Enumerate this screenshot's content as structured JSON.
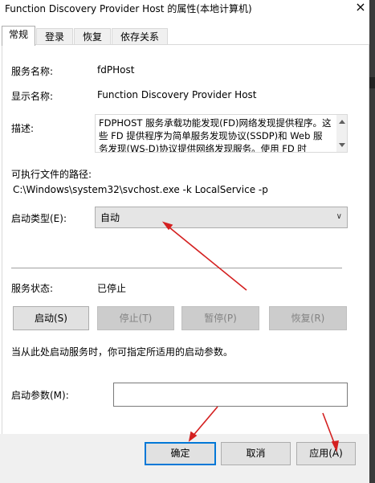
{
  "window": {
    "title": "Function Discovery Provider Host 的属性(本地计算机)",
    "close_glyph": "×"
  },
  "tabs": [
    {
      "label": "常规",
      "active": true
    },
    {
      "label": "登录",
      "active": false
    },
    {
      "label": "恢复",
      "active": false
    },
    {
      "label": "依存关系",
      "active": false
    }
  ],
  "general": {
    "service_name_label": "服务名称:",
    "service_name_value": "fdPHost",
    "display_name_label": "显示名称:",
    "display_name_value": "Function Discovery Provider Host",
    "description_label": "描述:",
    "description_text": "FDPHOST 服务承载功能发现(FD)网络发现提供程序。这些 FD 提供程序为简单服务发现协议(SSDP)和 Web 服务发现(WS-D)协议提供网络发现服务。使用 FD 时",
    "path_label": "可执行文件的路径:",
    "path_value": "C:\\Windows\\system32\\svchost.exe -k LocalService -p",
    "startup_type_label": "启动类型(E):",
    "startup_type_value": "自动",
    "service_status_label": "服务状态:",
    "service_status_value": "已停止",
    "buttons": {
      "start": "启动(S)",
      "stop": "停止(T)",
      "pause": "暂停(P)",
      "resume": "恢复(R)"
    },
    "hint_text": "当从此处启动服务时，你可指定所适用的启动参数。",
    "start_params_label": "启动参数(M):",
    "start_params_value": ""
  },
  "footer": {
    "ok": "确定",
    "cancel": "取消",
    "apply": "应用(A)"
  },
  "annotation_color": "#d42020"
}
